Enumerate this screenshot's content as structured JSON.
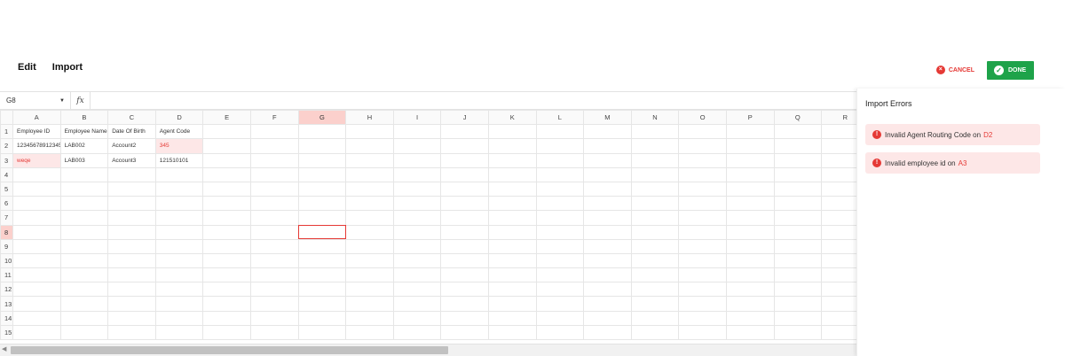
{
  "menu": {
    "edit": "Edit",
    "import": "Import"
  },
  "toolbar": {
    "cancel_label": "CANCEL",
    "done_label": "DONE"
  },
  "formula_bar": {
    "name_box": "G8",
    "fx": "fx",
    "formula": ""
  },
  "sheet": {
    "columns": [
      "A",
      "B",
      "C",
      "D",
      "E",
      "F",
      "G",
      "H",
      "I",
      "J",
      "K",
      "L",
      "M",
      "N",
      "O",
      "P",
      "Q",
      "R"
    ],
    "active_column": "G",
    "active_row": "8",
    "rows": [
      {
        "num": "1",
        "cells": [
          "Employee ID",
          "Employee Name",
          "Date Of Birth",
          "Agent Code"
        ]
      },
      {
        "num": "2",
        "cells": [
          "12345678912345",
          "LAB002",
          "Account2",
          "345"
        ]
      },
      {
        "num": "3",
        "cells": [
          "weqe",
          "LAB003",
          "Account3",
          "121510101"
        ]
      },
      {
        "num": "4",
        "cells": []
      },
      {
        "num": "5",
        "cells": []
      },
      {
        "num": "6",
        "cells": []
      },
      {
        "num": "7",
        "cells": []
      },
      {
        "num": "8",
        "cells": []
      },
      {
        "num": "9",
        "cells": []
      },
      {
        "num": "10",
        "cells": []
      },
      {
        "num": "11",
        "cells": []
      },
      {
        "num": "12",
        "cells": []
      },
      {
        "num": "13",
        "cells": []
      },
      {
        "num": "14",
        "cells": []
      },
      {
        "num": "15",
        "cells": []
      }
    ],
    "error_cells": [
      "D2",
      "A3"
    ]
  },
  "panel": {
    "title": "Import Errors",
    "errors": [
      {
        "message": "Invalid Agent Routing Code on",
        "ref": "D2"
      },
      {
        "message": "Invalid employee id on",
        "ref": "A3"
      }
    ]
  },
  "colors": {
    "accent_red": "#e53935",
    "done_green": "#1ea34a",
    "error_bg": "#fde7e7"
  }
}
